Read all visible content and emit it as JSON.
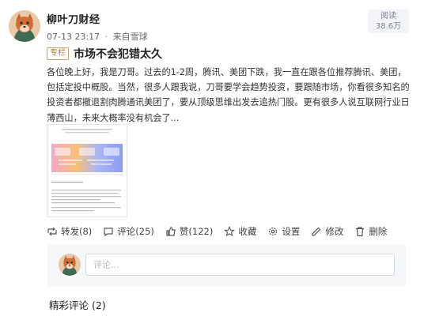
{
  "author": {
    "name": "柳叶刀财经"
  },
  "post": {
    "date": "07-13 23:17",
    "separator": "·",
    "source": "来自雪球",
    "read_label": "阅读",
    "read_count": "38.6万",
    "column_tag": "专栏",
    "title": "市场不会犯错太久",
    "body_lines": [
      "各位晚上好，我是刀哥。过去的1-2周，腾讯、美团下跌，我一直在跟各位推荐腾讯、美团，",
      "包括定投中概股。当然，很多人跟我说，刀哥要学会趋势投资，要跟随市场，你看很多知名的",
      "投资者都撤退割肉腾通讯美团了，要从顶级思维出发去追热门股。更有很多人说互联网行业日",
      "薄西山，未来大概率没有机会了..."
    ]
  },
  "actions": {
    "retweet": "转发(8)",
    "comment": "评论(25)",
    "like": "赞(122)",
    "favorite": "收藏",
    "settings": "设置",
    "edit": "修改",
    "delete": "删除"
  },
  "comment_box": {
    "placeholder": "评论..."
  },
  "featured_comments": {
    "label": "精彩评论",
    "count": "(2)"
  },
  "colors": {
    "tag_border": "#c4a36a",
    "tag_text": "#a87d36",
    "panel_bg": "#f6f7f9"
  }
}
